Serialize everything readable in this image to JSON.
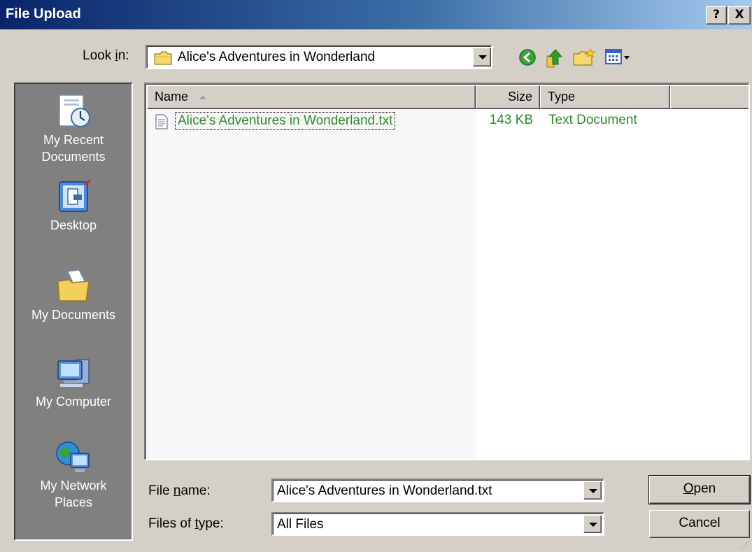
{
  "window": {
    "title": "File Upload",
    "help_glyph": "?",
    "close_glyph": "X"
  },
  "look_in": {
    "label_before": "Look ",
    "label_accel": "i",
    "label_after": "n:",
    "value": "Alice's Adventures in Wonderland"
  },
  "toolbar_icons": [
    "back-icon",
    "up-folder-icon",
    "new-folder-icon",
    "views-menu-icon"
  ],
  "places": [
    {
      "label": "My Recent\nDocuments",
      "icon": "recent-documents-icon"
    },
    {
      "label": "Desktop",
      "icon": "desktop-icon"
    },
    {
      "label": "My Documents",
      "icon": "my-documents-icon"
    },
    {
      "label": "My Computer",
      "icon": "my-computer-icon"
    },
    {
      "label": "My Network\nPlaces",
      "icon": "network-places-icon"
    }
  ],
  "columns": {
    "name": "Name",
    "size": "Size",
    "type": "Type"
  },
  "files": [
    {
      "name": "Alice's Adventures in Wonderland.txt",
      "size": "143 KB",
      "type": "Text Document"
    }
  ],
  "file_name": {
    "label_before": "File ",
    "label_accel": "n",
    "label_after": "ame:",
    "value": "Alice's Adventures in Wonderland.txt"
  },
  "file_type": {
    "label_before": "Files of ",
    "label_accel": "t",
    "label_after": "ype:",
    "value": "All Files"
  },
  "buttons": {
    "open_accel": "O",
    "open_rest": "pen",
    "cancel": "Cancel"
  },
  "colors": {
    "title_gradient_start": "#0a246a",
    "title_gradient_end": "#a6caf0",
    "file_text": "#2e8b2e",
    "dialog_face": "#d4d0c8",
    "places_bar": "#808080"
  }
}
